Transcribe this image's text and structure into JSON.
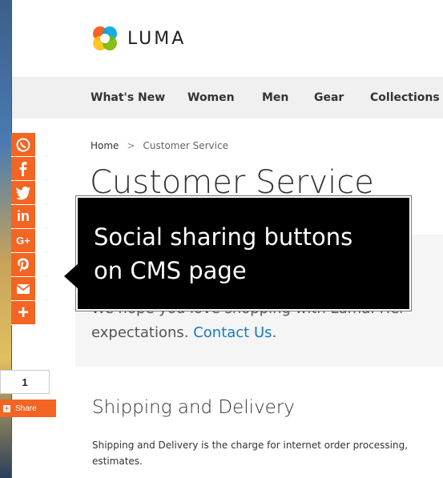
{
  "brand": {
    "name": "LUMA"
  },
  "nav": {
    "items": [
      "What's New",
      "Women",
      "Men",
      "Gear",
      "Collections"
    ]
  },
  "breadcrumb": {
    "home": "Home",
    "separator": ">",
    "current": "Customer Service"
  },
  "page": {
    "title": "Customer Service"
  },
  "intro": {
    "text_visible": "We hope you love shopping with Luma. Her",
    "text_line2": "expectations. ",
    "link": "Contact Us",
    "after_link": "."
  },
  "section": {
    "heading": "Shipping and Delivery",
    "body_line1": "Shipping and Delivery is the charge for internet order processing,",
    "body_line2": "estimates."
  },
  "social": {
    "buttons": [
      {
        "name": "whatsapp",
        "icon": "whatsapp-icon"
      },
      {
        "name": "facebook",
        "icon": "facebook-icon"
      },
      {
        "name": "twitter",
        "icon": "twitter-icon"
      },
      {
        "name": "linkedin",
        "icon": "linkedin-icon",
        "label": "in"
      },
      {
        "name": "google-plus",
        "icon": "google-plus-icon",
        "label": "G+"
      },
      {
        "name": "pinterest",
        "icon": "pinterest-icon"
      },
      {
        "name": "email",
        "icon": "email-icon"
      },
      {
        "name": "more",
        "icon": "plus-icon",
        "label": "+"
      }
    ],
    "share_count": "1",
    "share_label": "Share",
    "accent_color": "#f26522"
  },
  "callout": {
    "line1": "Social sharing buttons",
    "line2": "on CMS page"
  }
}
